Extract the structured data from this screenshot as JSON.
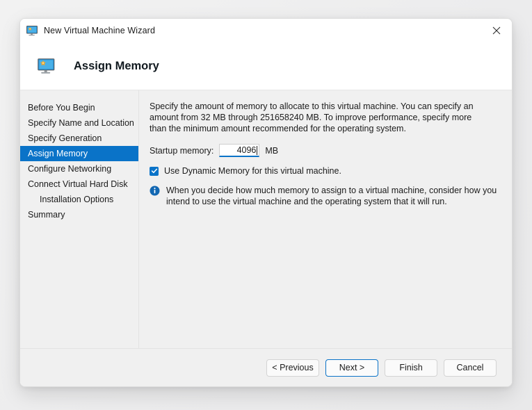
{
  "window": {
    "title": "New Virtual Machine Wizard",
    "title_icon": "virtual-machine-monitor-icon",
    "close_icon": "close-icon"
  },
  "header": {
    "icon": "virtual-machine-monitor-icon",
    "title": "Assign Memory"
  },
  "sidebar": {
    "items": [
      {
        "label": "Before You Begin",
        "selected": false,
        "indented": false
      },
      {
        "label": "Specify Name and Location",
        "selected": false,
        "indented": false
      },
      {
        "label": "Specify Generation",
        "selected": false,
        "indented": false
      },
      {
        "label": "Assign Memory",
        "selected": true,
        "indented": false
      },
      {
        "label": "Configure Networking",
        "selected": false,
        "indented": false
      },
      {
        "label": "Connect Virtual Hard Disk",
        "selected": false,
        "indented": false
      },
      {
        "label": "Installation Options",
        "selected": false,
        "indented": true
      },
      {
        "label": "Summary",
        "selected": false,
        "indented": false
      }
    ]
  },
  "content": {
    "intro_paragraph": "Specify the amount of memory to allocate to this virtual machine. You can specify an amount from 32 MB through 251658240 MB. To improve performance, specify more than the minimum amount recommended for the operating system.",
    "startup_memory": {
      "label": "Startup memory:",
      "value": "4096",
      "unit": "MB",
      "focused": true
    },
    "dynamic_memory": {
      "label": "Use Dynamic Memory for this virtual machine.",
      "checked": true
    },
    "info_note": {
      "icon": "info-icon",
      "text": "When you decide how much memory to assign to a virtual machine, consider how you intend to use the virtual machine and the operating system that it will run."
    }
  },
  "footer": {
    "buttons": [
      {
        "label": "< Previous",
        "default": false
      },
      {
        "label": "Next >",
        "default": true
      },
      {
        "label": "Finish",
        "default": false
      },
      {
        "label": "Cancel",
        "default": false
      }
    ]
  },
  "colors": {
    "accent": "#0a73c8",
    "window_background": "#ffffff",
    "body_background": "#f0f0f0",
    "text": "#1b1b1b"
  }
}
